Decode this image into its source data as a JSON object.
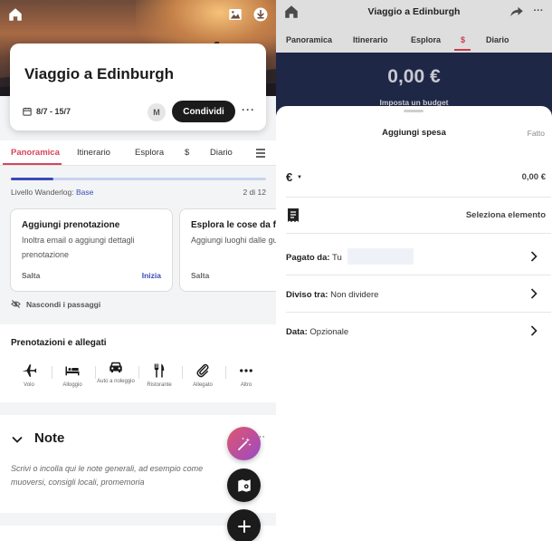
{
  "left": {
    "trip": {
      "title": "Viaggio a Edinburgh",
      "dates": "8/7 - 15/7",
      "avatar_initial": "M",
      "share_label": "Condividi",
      "more_label": "···"
    },
    "tabs": [
      {
        "label": "Panoramica",
        "active": true
      },
      {
        "label": "Itinerario"
      },
      {
        "label": "Esplora"
      },
      {
        "label": "$"
      },
      {
        "label": "Diario"
      }
    ],
    "level": {
      "label": "Livello Wanderlog:",
      "value": "Base",
      "count": "2 di 12",
      "progress": 0.167
    },
    "suggestions": [
      {
        "title": "Aggiungi prenotazione",
        "body": "Inoltra email o aggiungi dettagli prenotazione",
        "skip": "Salta",
        "action": "Inizia"
      },
      {
        "title": "Esplora le cose da fare",
        "body": "Aggiungi luoghi dalle guide top",
        "skip": "Salta"
      }
    ],
    "hide_tips": "Nascondi i passaggi",
    "bookings": {
      "title": "Prenotazioni e allegati",
      "items": [
        {
          "label": "Volo",
          "icon": "plane-icon"
        },
        {
          "label": "Alloggio",
          "icon": "bed-icon"
        },
        {
          "label": "Auto a noleggio",
          "icon": "car-icon"
        },
        {
          "label": "Ristorante",
          "icon": "cutlery-icon"
        },
        {
          "label": "Allegato",
          "icon": "paperclip-icon"
        },
        {
          "label": "Altro",
          "icon": "more-icon"
        }
      ]
    },
    "notes": {
      "title": "Note",
      "placeholder": "Scrivi o incolla qui le note generali, ad esempio come muoversi, consigli locali, promemoria",
      "more_label": "···"
    },
    "colors": {
      "accent": "#d6455b",
      "link": "#3a4cb8",
      "fab_dark": "#1b1b1b"
    }
  },
  "right": {
    "title": "Viaggio a Edinburgh",
    "tabs": [
      {
        "label": "Panoramica"
      },
      {
        "label": "Itinerario"
      },
      {
        "label": "Esplora"
      },
      {
        "label": "$",
        "active": true
      },
      {
        "label": "Diario"
      }
    ],
    "budget": {
      "amount": "0,00 €",
      "set_budget": "Imposta un budget"
    },
    "sheet": {
      "title": "Aggiungi spesa",
      "done": "Fatto",
      "currency_symbol": "€",
      "amount_value": "0,00 €",
      "category_label": "Seleziona elemento",
      "paid_by_label": "Pagato da:",
      "paid_by_value": "Tu",
      "split_label": "Diviso tra:",
      "split_value": "Non dividere",
      "date_label": "Data:",
      "date_value": "Opzionale"
    },
    "colors": {
      "budget_bg": "#1f2747",
      "accent": "#c83d50"
    }
  }
}
